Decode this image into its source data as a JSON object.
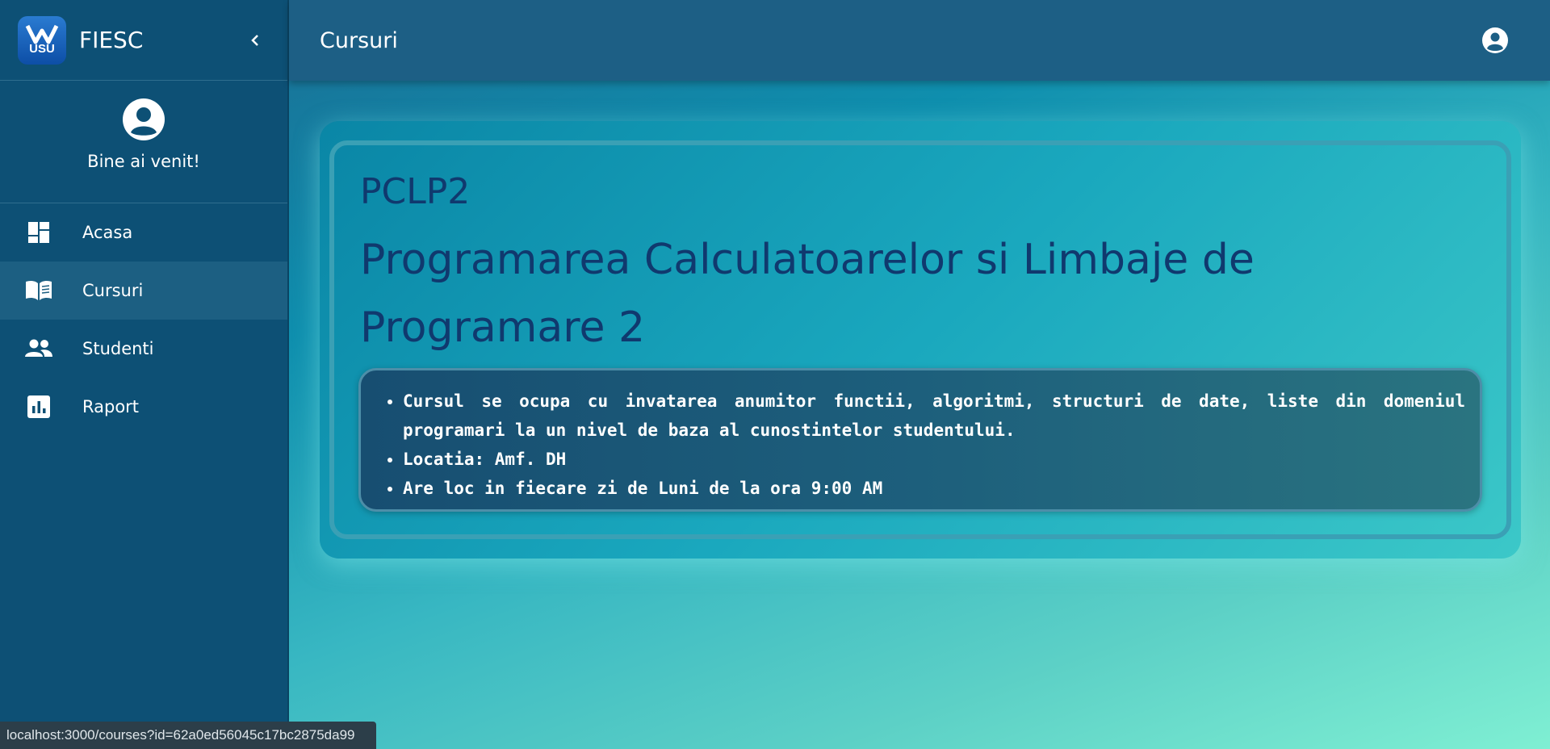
{
  "sidebar": {
    "brand": {
      "logo_text": "USU",
      "name": "FIESC"
    },
    "welcome": "Bine ai venit!",
    "items": [
      {
        "label": "Acasa",
        "icon": "dashboard-icon",
        "active": false
      },
      {
        "label": "Cursuri",
        "icon": "book-open-icon",
        "active": true
      },
      {
        "label": "Studenti",
        "icon": "people-icon",
        "active": false
      },
      {
        "label": "Raport",
        "icon": "bar-chart-icon",
        "active": false
      }
    ]
  },
  "header": {
    "title": "Cursuri",
    "account_icon": "account-circle-icon"
  },
  "course": {
    "code": "PCLP2",
    "name": "Programarea Calculatoarelor si Limbaje de Programare 2",
    "details": [
      "Cursul se ocupa cu invatarea anumitor functii, algoritmi, structuri de date, liste din domeniul programari la un nivel de baza al cunostintelor studentului.",
      "Locatia: Amf. DH",
      "Are loc in fiecare zi de Luni de la ora 9:00 AM"
    ]
  },
  "status_bar": {
    "url": "localhost:3000/courses?id=62a0ed56045c17bc2875da99"
  },
  "colors": {
    "sidebar": "#0d5075",
    "topbar": "#1d5f85",
    "title_text": "#10396e",
    "info_box": "#174e71"
  }
}
